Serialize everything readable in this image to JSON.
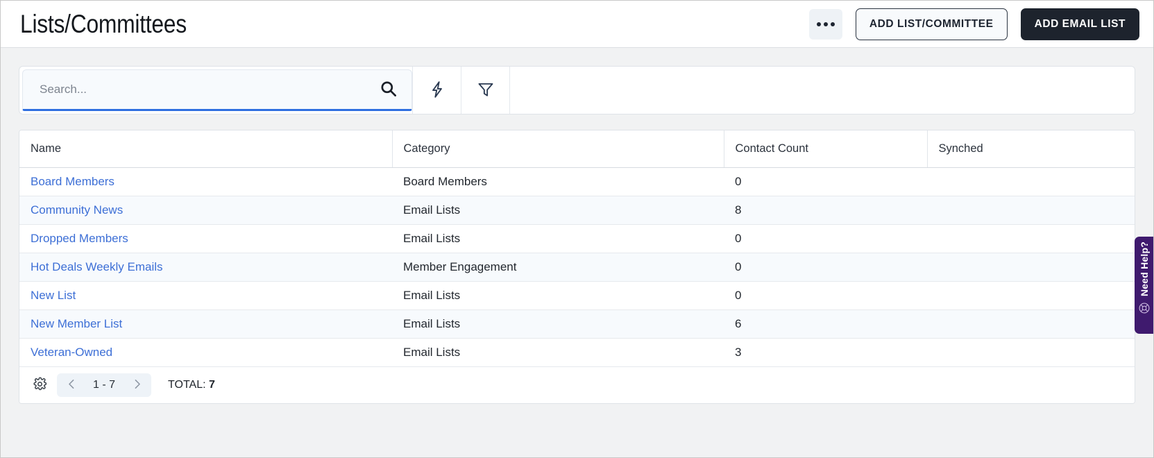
{
  "header": {
    "title": "Lists/Committees",
    "kebab_label": "",
    "add_list_committee_label": "ADD LIST/COMMITTEE",
    "add_email_list_label": "ADD EMAIL LIST"
  },
  "toolbar": {
    "search_placeholder": "Search...",
    "search_value": "",
    "icons": {
      "search": "search-icon",
      "quick_action": "lightning-bolt-icon",
      "filter": "funnel-filter-icon"
    }
  },
  "table": {
    "columns": [
      "Name",
      "Category",
      "Contact Count",
      "Synched"
    ],
    "rows": [
      {
        "name": "Board Members",
        "category": "Board Members",
        "contact_count": "0",
        "synched": ""
      },
      {
        "name": "Community News",
        "category": "Email Lists",
        "contact_count": "8",
        "synched": ""
      },
      {
        "name": "Dropped Members",
        "category": "Email Lists",
        "contact_count": "0",
        "synched": ""
      },
      {
        "name": "Hot Deals Weekly Emails",
        "category": "Member Engagement",
        "contact_count": "0",
        "synched": ""
      },
      {
        "name": "New List",
        "category": "Email Lists",
        "contact_count": "0",
        "synched": ""
      },
      {
        "name": "New Member List",
        "category": "Email Lists",
        "contact_count": "6",
        "synched": ""
      },
      {
        "name": "Veteran-Owned",
        "category": "Email Lists",
        "contact_count": "3",
        "synched": ""
      }
    ]
  },
  "footer": {
    "settings_icon": "gear-icon",
    "prev_label": "",
    "next_label": "",
    "range": "1 - 7",
    "total_prefix": "TOTAL:",
    "total_value": "7"
  },
  "help_tab": {
    "label": "Need Help?",
    "icon": "lifebuoy-icon"
  },
  "colors": {
    "accent_blue": "#2f6fe0",
    "link_blue": "#3d6fd6",
    "dark_button": "#1d232d",
    "help_purple": "#3f1a6e",
    "page_background": "#f1f2f3",
    "row_alt": "#f7fafd"
  }
}
